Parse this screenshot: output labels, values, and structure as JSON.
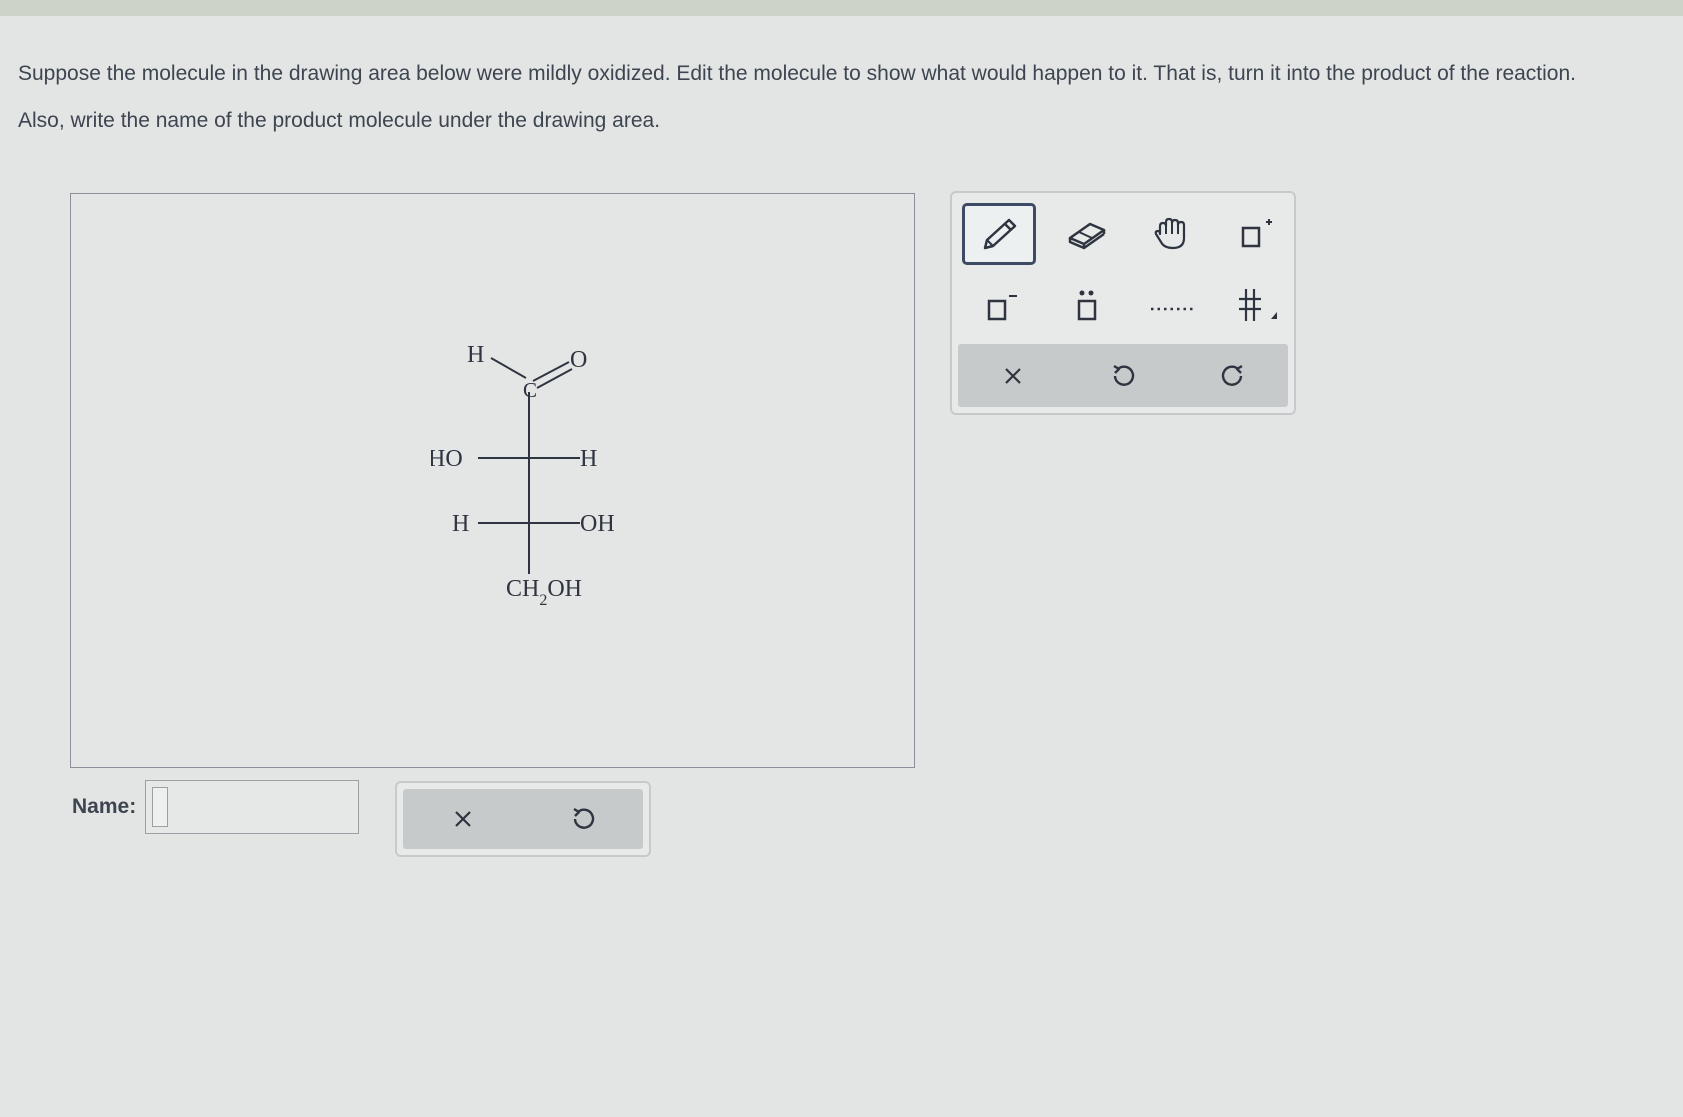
{
  "question": {
    "line1": "Suppose the molecule in the drawing area below were mildly oxidized. Edit the molecule to show what would happen to it. That is, turn it into the product of the reaction.",
    "line2": "Also, write the name of the product molecule under the drawing area."
  },
  "molecule": {
    "top_h": "H",
    "carbonyl_c": "C",
    "carbonyl_o": "O",
    "row1_left": "HO",
    "row1_right": "H",
    "row2_left": "H",
    "row2_right": "OH",
    "bottom_ch": "CH",
    "bottom_sub": "2",
    "bottom_oh": "OH"
  },
  "toolbar": {
    "tools": [
      {
        "name": "pencil-tool",
        "icon": "pencil-icon",
        "active": true
      },
      {
        "name": "eraser-tool",
        "icon": "eraser-icon",
        "active": false
      },
      {
        "name": "hand-tool",
        "icon": "hand-icon",
        "active": false
      },
      {
        "name": "positive-charge-tool",
        "icon": "positive-charge-icon",
        "active": false
      },
      {
        "name": "negative-charge-tool",
        "icon": "negative-charge-icon",
        "active": false
      },
      {
        "name": "lone-pair-tool",
        "icon": "lone-pair-icon",
        "active": false
      },
      {
        "name": "dotted-bond-tool",
        "icon": "dotted-bond-icon",
        "active": false
      },
      {
        "name": "bond-menu-tool",
        "icon": "bond-menu-icon",
        "active": false
      }
    ],
    "actions": [
      "clear-icon",
      "undo-icon",
      "redo-icon"
    ]
  },
  "name_field": {
    "label": "Name:",
    "value": ""
  },
  "bottom_actions": [
    "clear-icon",
    "undo-icon"
  ],
  "colors": {
    "background": "#e2e5e4",
    "text": "#3e4550",
    "active_border": "#3d4a64",
    "action_bar": "#c6cacb"
  }
}
